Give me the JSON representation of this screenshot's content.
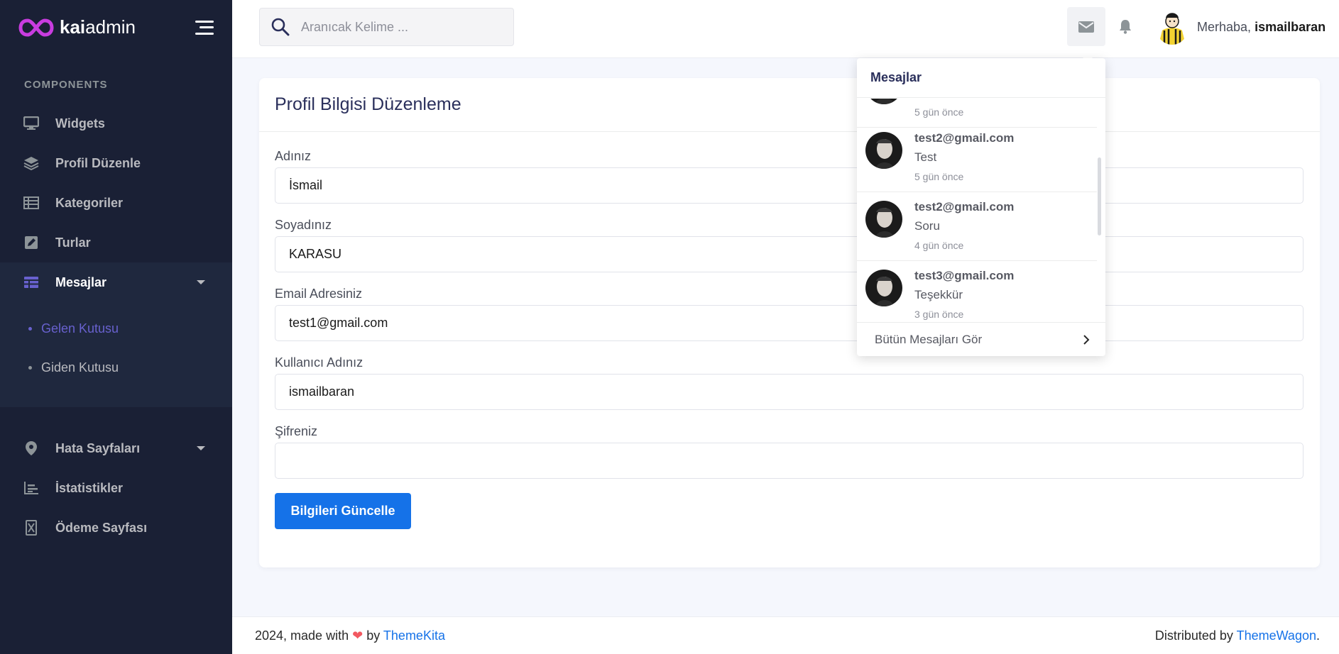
{
  "brand": {
    "bold": "kai",
    "light": "admin"
  },
  "sidebar": {
    "section_title": "COMPONENTS",
    "items": [
      {
        "label": "Widgets",
        "icon": "desktop-icon"
      },
      {
        "label": "Profil Düzenle",
        "icon": "layers-icon"
      },
      {
        "label": "Kategoriler",
        "icon": "table-icon"
      },
      {
        "label": "Turlar",
        "icon": "edit-icon"
      },
      {
        "label": "Mesajlar",
        "icon": "grid-icon"
      }
    ],
    "subitems": [
      {
        "label": "Gelen Kutusu"
      },
      {
        "label": "Giden Kutusu"
      }
    ],
    "items2": [
      {
        "label": "Hata Sayfaları",
        "icon": "map-pin-icon"
      },
      {
        "label": "İstatistikler",
        "icon": "bar-chart-icon"
      },
      {
        "label": "Ödeme Sayfası",
        "icon": "invoice-icon"
      }
    ]
  },
  "header": {
    "search_placeholder": "Aranıcak Kelime ...",
    "greeting": "Merhaba,",
    "username": "ismailbaran"
  },
  "card": {
    "title": "Profil Bilgisi Düzenleme",
    "fields": [
      {
        "label": "Adınız",
        "value": "İsmail"
      },
      {
        "label": "Soyadınız",
        "value": "KARASU"
      },
      {
        "label": "Email Adresiniz",
        "value": "test1@gmail.com"
      },
      {
        "label": "Kullanıcı Adınız",
        "value": "ismailbaran"
      },
      {
        "label": "Şifreniz",
        "value": ""
      }
    ],
    "submit_label": "Bilgileri Güncelle"
  },
  "messages_dropdown": {
    "title": "Mesajlar",
    "items": [
      {
        "from": "",
        "text": "",
        "time": "5 gün önce"
      },
      {
        "from": "test2@gmail.com",
        "text": "Test",
        "time": "5 gün önce"
      },
      {
        "from": "test2@gmail.com",
        "text": "Soru",
        "time": "4 gün önce"
      },
      {
        "from": "test3@gmail.com",
        "text": "Teşekkür",
        "time": "3 gün önce"
      }
    ],
    "see_all": "Bütün Mesajları Gör"
  },
  "footer": {
    "left_prefix": "2024, made with",
    "left_by": "by",
    "left_link": "ThemeKita",
    "right_prefix": "Distributed by",
    "right_link": "ThemeWagon",
    "right_suffix": "."
  },
  "colors": {
    "sidebar_bg": "#1a2035",
    "accent": "#6861ce",
    "primary": "#1572e8"
  }
}
